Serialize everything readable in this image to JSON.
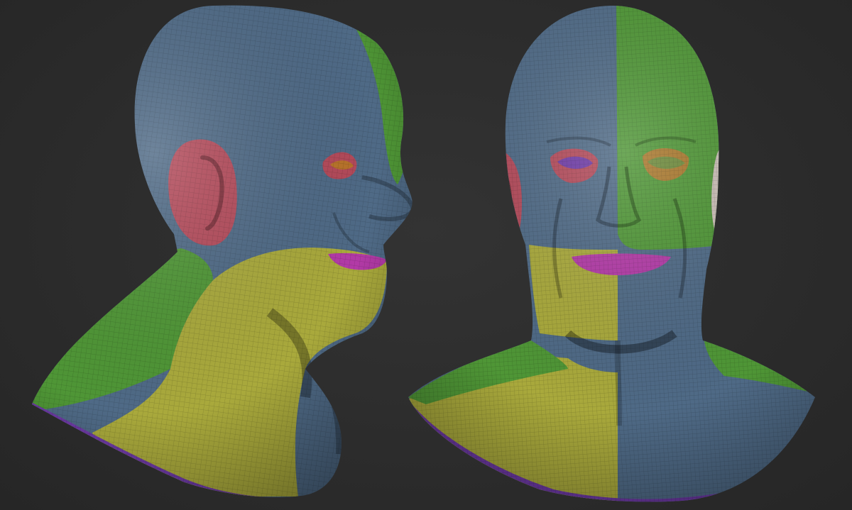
{
  "scene": {
    "views": [
      {
        "name": "three-quarter-view"
      },
      {
        "name": "front-view"
      }
    ],
    "polygroup_colors": {
      "blue": "#4f6a86",
      "green": "#4f9636",
      "yellow": "#a9a93c",
      "red": "#b34a5a",
      "magenta": "#b23aa6",
      "purple": "#6e3aa6",
      "white": "#c9bdb6",
      "orange": "#b8732a"
    },
    "background": "#2b2b2b"
  }
}
